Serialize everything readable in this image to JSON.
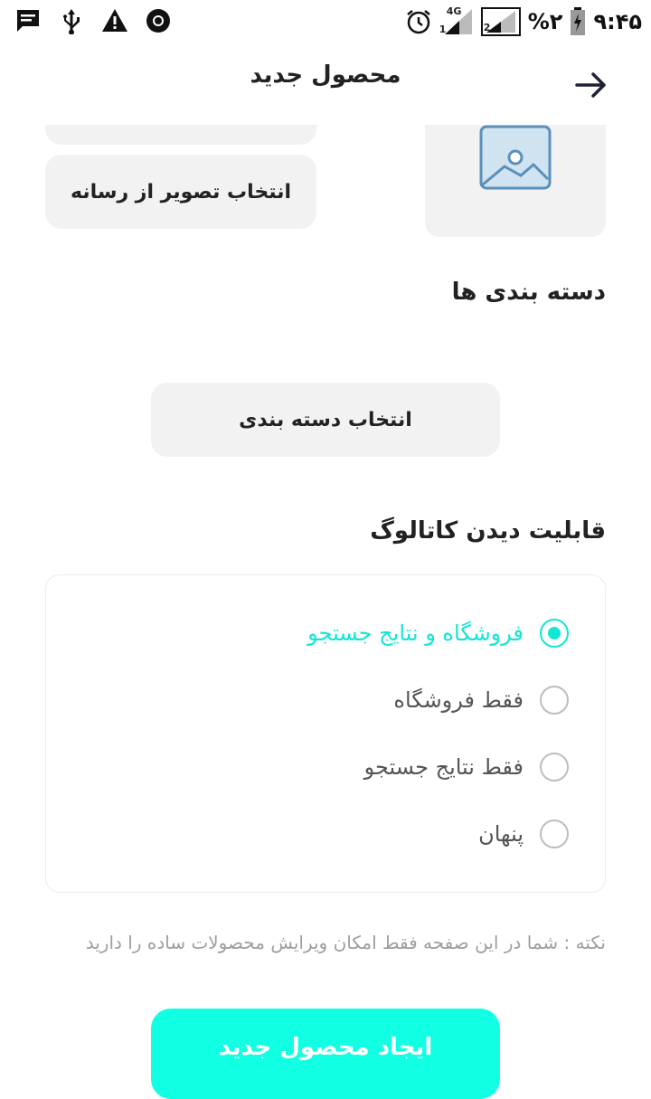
{
  "status_bar": {
    "time": "۹:۴۵",
    "battery": "%۲",
    "network_label": "4G",
    "sim1": "1",
    "sim2": "2",
    "icons": [
      "message-icon",
      "usb-icon",
      "warning-icon",
      "chrome-icon",
      "alarm-icon",
      "signal-icon",
      "battery-charging-icon"
    ]
  },
  "header": {
    "title": "محصول جدید",
    "back_icon": "arrow-right-icon"
  },
  "media": {
    "select_media_label": "انتخاب تصویر از رسانه",
    "placeholder_icon": "image-placeholder-icon"
  },
  "categories": {
    "title": "دسته بندی ها",
    "select_label": "انتخاب دسته بندی"
  },
  "visibility": {
    "title": "قابلیت دیدن کاتالوگ",
    "options": [
      {
        "label": "فروشگاه و نتایج جستجو",
        "selected": true
      },
      {
        "label": "فقط فروشگاه",
        "selected": false
      },
      {
        "label": "فقط نتایج جستجو",
        "selected": false
      },
      {
        "label": "پنهان",
        "selected": false
      }
    ]
  },
  "note": "نکته :  شما در این صفحه فقط امکان ویرایش محصولات ساده را دارید",
  "cta": {
    "label": "ایجاد محصول جدید"
  },
  "colors": {
    "accent": "#12e6d4",
    "cta_bg": "#11ffe2",
    "pill_bg": "#f2f2f2",
    "icon_blue": "#5b8fb9"
  }
}
